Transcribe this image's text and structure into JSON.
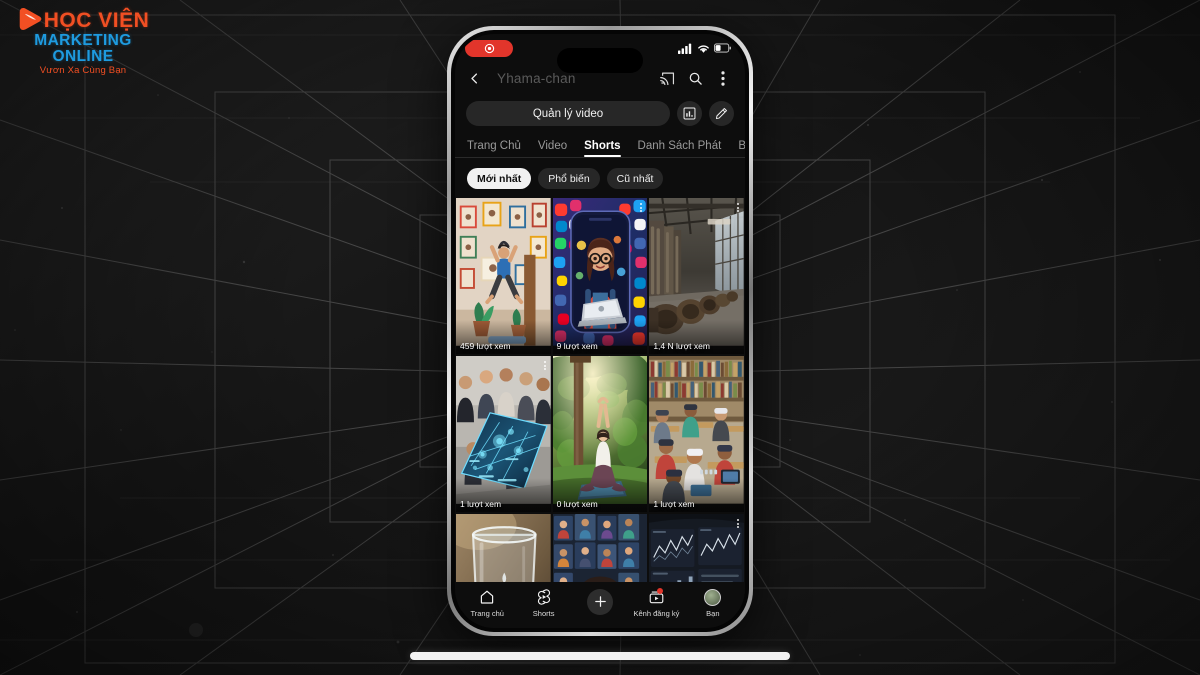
{
  "branding": {
    "logo_title": "HỌC VIỆN",
    "logo_subtitle": "MARKETING ONLINE",
    "logo_slogan": "Vươn Xa Cùng Bạn",
    "color_orange": "#f24f23",
    "color_blue": "#1e9be0"
  },
  "background": {
    "style": "dark-3d-perspective-wireframe-grid",
    "base_color": "#1a1a1a",
    "line_color": "#6e6e6e"
  },
  "phone": {
    "frame_color": "#c9c9c9",
    "screen_background": "#0d0d0d",
    "status_bar": {
      "recording_icon": "record-pill-icon",
      "signal_icon": "cellular-signal-icon",
      "wifi_icon": "wifi-icon",
      "battery_icon": "battery-icon"
    },
    "header": {
      "back_icon": "back-arrow-icon",
      "channel_name": "Yhama-chan",
      "cast_icon": "cast-icon",
      "search_icon": "search-icon",
      "more_icon": "more-vertical-icon"
    },
    "actions": {
      "manage_label": "Quản lý video",
      "analytics_icon": "bar-chart-icon",
      "edit_icon": "pencil-icon"
    },
    "tabs": [
      {
        "label": "Trang Chủ",
        "active": false
      },
      {
        "label": "Video",
        "active": false
      },
      {
        "label": "Shorts",
        "active": true
      },
      {
        "label": "Danh Sách Phát",
        "active": false
      },
      {
        "label": "B",
        "active": false
      }
    ],
    "filter_chips": [
      {
        "label": "Mới nhất",
        "active": true
      },
      {
        "label": "Phổ biến",
        "active": false
      },
      {
        "label": "Cũ nhất",
        "active": false
      }
    ],
    "videos": [
      {
        "views": "459 lượt xem",
        "thumb": "man-jumping-poster-wall",
        "kebab": false
      },
      {
        "views": "9 lượt xem",
        "thumb": "girl-laptop-social-icons",
        "kebab": true
      },
      {
        "views": "1,4 N lượt xem",
        "thumb": "industrial-factory-hall",
        "kebab": true
      },
      {
        "views": "1 lượt xem",
        "thumb": "team-holographic-table",
        "kebab": true
      },
      {
        "views": "0 lượt xem",
        "thumb": "woman-yoga-garden",
        "kebab": false
      },
      {
        "views": "1 lượt xem",
        "thumb": "vr-classroom-library",
        "kebab": false
      },
      {
        "views": "",
        "thumb": "water-glass-closeup",
        "kebab": false
      },
      {
        "views": "",
        "thumb": "cartoon-girl-screens",
        "kebab": false
      },
      {
        "views": "",
        "thumb": "dark-analytics-dashboard",
        "kebab": true
      }
    ],
    "bottom_nav": [
      {
        "label": "Trang chủ",
        "icon": "home-icon",
        "badge": false
      },
      {
        "label": "Shorts",
        "icon": "shorts-icon",
        "badge": false
      },
      {
        "label": "",
        "icon": "plus-icon",
        "badge": false
      },
      {
        "label": "Kênh đăng ký",
        "icon": "subscriptions-icon",
        "badge": true
      },
      {
        "label": "Bạn",
        "icon": "account-avatar-icon",
        "badge": false
      }
    ]
  },
  "overlay": {
    "home_indicator": "white-home-indicator-bar"
  }
}
